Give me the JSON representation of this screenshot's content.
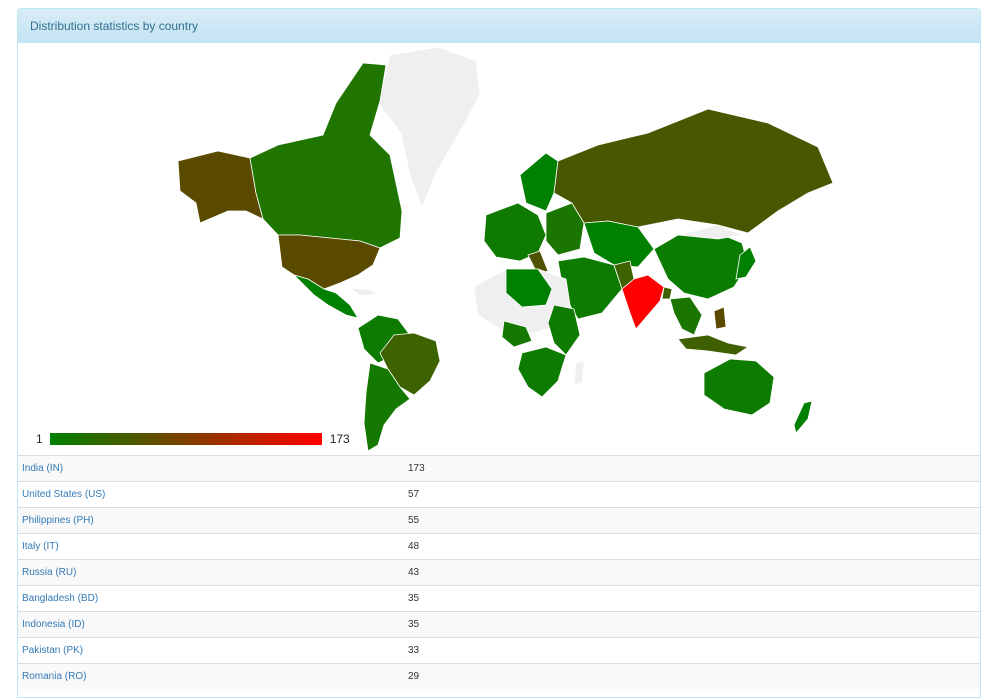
{
  "panel": {
    "title": "Distribution statistics by country"
  },
  "legend": {
    "min": "1",
    "max": "173",
    "color_low": "#008000",
    "color_high": "#ff0000"
  },
  "colors": {
    "no_data": "#efefef",
    "heading_bg": "#d9edf7",
    "heading_text": "#31708f",
    "link": "#337ab7"
  },
  "rows": [
    {
      "country": "India (IN)",
      "value": "173",
      "color": "#ff0000"
    },
    {
      "country": "United States (US)",
      "value": "57",
      "color": "#5a4a00"
    },
    {
      "country": "Philippines (PH)",
      "value": "55",
      "color": "#5c4900"
    },
    {
      "country": "Italy (IT)",
      "value": "48",
      "color": "#4e5200"
    },
    {
      "country": "Russia (RU)",
      "value": "43",
      "color": "#485800"
    },
    {
      "country": "Bangladesh (BD)",
      "value": "35",
      "color": "#3f6000"
    },
    {
      "country": "Indonesia (ID)",
      "value": "35",
      "color": "#3f6000"
    },
    {
      "country": "Pakistan (PK)",
      "value": "33",
      "color": "#3d6200"
    },
    {
      "country": "Romania (RO)",
      "value": "29",
      "color": "#386600"
    }
  ]
}
